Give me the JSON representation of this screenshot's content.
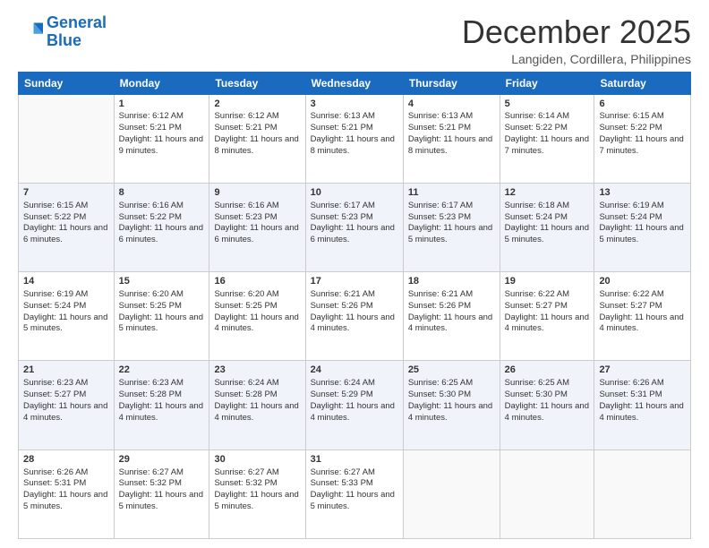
{
  "logo": {
    "line1": "General",
    "line2": "Blue"
  },
  "title": "December 2025",
  "subtitle": "Langiden, Cordillera, Philippines",
  "days_of_week": [
    "Sunday",
    "Monday",
    "Tuesday",
    "Wednesday",
    "Thursday",
    "Friday",
    "Saturday"
  ],
  "weeks": [
    [
      {
        "num": "",
        "sunrise": "",
        "sunset": "",
        "daylight": ""
      },
      {
        "num": "1",
        "sunrise": "Sunrise: 6:12 AM",
        "sunset": "Sunset: 5:21 PM",
        "daylight": "Daylight: 11 hours and 9 minutes."
      },
      {
        "num": "2",
        "sunrise": "Sunrise: 6:12 AM",
        "sunset": "Sunset: 5:21 PM",
        "daylight": "Daylight: 11 hours and 8 minutes."
      },
      {
        "num": "3",
        "sunrise": "Sunrise: 6:13 AM",
        "sunset": "Sunset: 5:21 PM",
        "daylight": "Daylight: 11 hours and 8 minutes."
      },
      {
        "num": "4",
        "sunrise": "Sunrise: 6:13 AM",
        "sunset": "Sunset: 5:21 PM",
        "daylight": "Daylight: 11 hours and 8 minutes."
      },
      {
        "num": "5",
        "sunrise": "Sunrise: 6:14 AM",
        "sunset": "Sunset: 5:22 PM",
        "daylight": "Daylight: 11 hours and 7 minutes."
      },
      {
        "num": "6",
        "sunrise": "Sunrise: 6:15 AM",
        "sunset": "Sunset: 5:22 PM",
        "daylight": "Daylight: 11 hours and 7 minutes."
      }
    ],
    [
      {
        "num": "7",
        "sunrise": "Sunrise: 6:15 AM",
        "sunset": "Sunset: 5:22 PM",
        "daylight": "Daylight: 11 hours and 6 minutes."
      },
      {
        "num": "8",
        "sunrise": "Sunrise: 6:16 AM",
        "sunset": "Sunset: 5:22 PM",
        "daylight": "Daylight: 11 hours and 6 minutes."
      },
      {
        "num": "9",
        "sunrise": "Sunrise: 6:16 AM",
        "sunset": "Sunset: 5:23 PM",
        "daylight": "Daylight: 11 hours and 6 minutes."
      },
      {
        "num": "10",
        "sunrise": "Sunrise: 6:17 AM",
        "sunset": "Sunset: 5:23 PM",
        "daylight": "Daylight: 11 hours and 6 minutes."
      },
      {
        "num": "11",
        "sunrise": "Sunrise: 6:17 AM",
        "sunset": "Sunset: 5:23 PM",
        "daylight": "Daylight: 11 hours and 5 minutes."
      },
      {
        "num": "12",
        "sunrise": "Sunrise: 6:18 AM",
        "sunset": "Sunset: 5:24 PM",
        "daylight": "Daylight: 11 hours and 5 minutes."
      },
      {
        "num": "13",
        "sunrise": "Sunrise: 6:19 AM",
        "sunset": "Sunset: 5:24 PM",
        "daylight": "Daylight: 11 hours and 5 minutes."
      }
    ],
    [
      {
        "num": "14",
        "sunrise": "Sunrise: 6:19 AM",
        "sunset": "Sunset: 5:24 PM",
        "daylight": "Daylight: 11 hours and 5 minutes."
      },
      {
        "num": "15",
        "sunrise": "Sunrise: 6:20 AM",
        "sunset": "Sunset: 5:25 PM",
        "daylight": "Daylight: 11 hours and 5 minutes."
      },
      {
        "num": "16",
        "sunrise": "Sunrise: 6:20 AM",
        "sunset": "Sunset: 5:25 PM",
        "daylight": "Daylight: 11 hours and 4 minutes."
      },
      {
        "num": "17",
        "sunrise": "Sunrise: 6:21 AM",
        "sunset": "Sunset: 5:26 PM",
        "daylight": "Daylight: 11 hours and 4 minutes."
      },
      {
        "num": "18",
        "sunrise": "Sunrise: 6:21 AM",
        "sunset": "Sunset: 5:26 PM",
        "daylight": "Daylight: 11 hours and 4 minutes."
      },
      {
        "num": "19",
        "sunrise": "Sunrise: 6:22 AM",
        "sunset": "Sunset: 5:27 PM",
        "daylight": "Daylight: 11 hours and 4 minutes."
      },
      {
        "num": "20",
        "sunrise": "Sunrise: 6:22 AM",
        "sunset": "Sunset: 5:27 PM",
        "daylight": "Daylight: 11 hours and 4 minutes."
      }
    ],
    [
      {
        "num": "21",
        "sunrise": "Sunrise: 6:23 AM",
        "sunset": "Sunset: 5:27 PM",
        "daylight": "Daylight: 11 hours and 4 minutes."
      },
      {
        "num": "22",
        "sunrise": "Sunrise: 6:23 AM",
        "sunset": "Sunset: 5:28 PM",
        "daylight": "Daylight: 11 hours and 4 minutes."
      },
      {
        "num": "23",
        "sunrise": "Sunrise: 6:24 AM",
        "sunset": "Sunset: 5:28 PM",
        "daylight": "Daylight: 11 hours and 4 minutes."
      },
      {
        "num": "24",
        "sunrise": "Sunrise: 6:24 AM",
        "sunset": "Sunset: 5:29 PM",
        "daylight": "Daylight: 11 hours and 4 minutes."
      },
      {
        "num": "25",
        "sunrise": "Sunrise: 6:25 AM",
        "sunset": "Sunset: 5:30 PM",
        "daylight": "Daylight: 11 hours and 4 minutes."
      },
      {
        "num": "26",
        "sunrise": "Sunrise: 6:25 AM",
        "sunset": "Sunset: 5:30 PM",
        "daylight": "Daylight: 11 hours and 4 minutes."
      },
      {
        "num": "27",
        "sunrise": "Sunrise: 6:26 AM",
        "sunset": "Sunset: 5:31 PM",
        "daylight": "Daylight: 11 hours and 4 minutes."
      }
    ],
    [
      {
        "num": "28",
        "sunrise": "Sunrise: 6:26 AM",
        "sunset": "Sunset: 5:31 PM",
        "daylight": "Daylight: 11 hours and 5 minutes."
      },
      {
        "num": "29",
        "sunrise": "Sunrise: 6:27 AM",
        "sunset": "Sunset: 5:32 PM",
        "daylight": "Daylight: 11 hours and 5 minutes."
      },
      {
        "num": "30",
        "sunrise": "Sunrise: 6:27 AM",
        "sunset": "Sunset: 5:32 PM",
        "daylight": "Daylight: 11 hours and 5 minutes."
      },
      {
        "num": "31",
        "sunrise": "Sunrise: 6:27 AM",
        "sunset": "Sunset: 5:33 PM",
        "daylight": "Daylight: 11 hours and 5 minutes."
      },
      {
        "num": "",
        "sunrise": "",
        "sunset": "",
        "daylight": ""
      },
      {
        "num": "",
        "sunrise": "",
        "sunset": "",
        "daylight": ""
      },
      {
        "num": "",
        "sunrise": "",
        "sunset": "",
        "daylight": ""
      }
    ]
  ]
}
